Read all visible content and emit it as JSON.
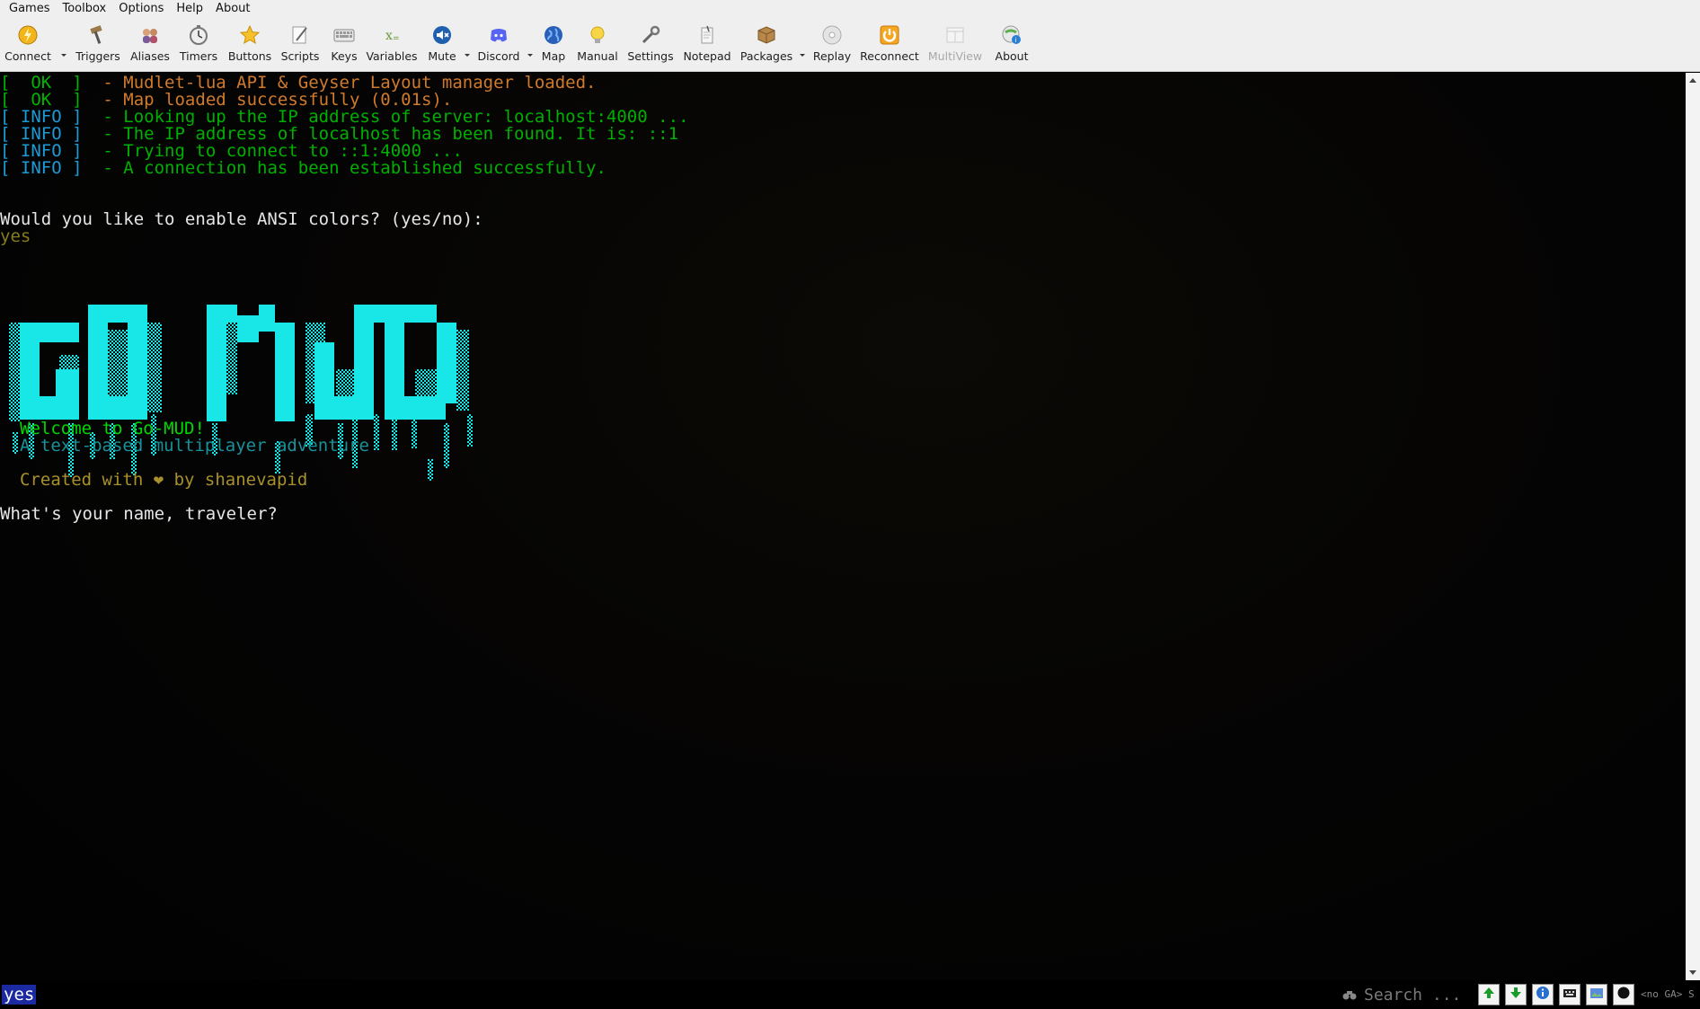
{
  "menu": [
    "Games",
    "Toolbox",
    "Options",
    "Help",
    "About"
  ],
  "toolbar": {
    "connect": "Connect",
    "triggers": "Triggers",
    "aliases": "Aliases",
    "timers": "Timers",
    "buttons": "Buttons",
    "scripts": "Scripts",
    "keys": "Keys",
    "variables": "Variables",
    "mute": "Mute",
    "discord": "Discord",
    "map": "Map",
    "manual": "Manual",
    "settings": "Settings",
    "notepad": "Notepad",
    "packages": "Packages",
    "replay": "Replay",
    "reconnect": "Reconnect",
    "multiview": "MultiView",
    "about": "About"
  },
  "console": {
    "log": [
      {
        "open": "[  ",
        "status": "OK",
        "close": "  ]",
        "message": "  - Mudlet-lua API & Geyser Layout manager loaded.",
        "kind": "ok",
        "color": "#d07a2c"
      },
      {
        "open": "[  ",
        "status": "OK",
        "close": "  ]",
        "message": "  - Map loaded successfully (0.01s).",
        "kind": "ok",
        "color": "#d07a2c"
      },
      {
        "open": "[ ",
        "status": "INFO",
        "close": " ]",
        "message": "  - Looking up the IP address of server: localhost:4000 ...",
        "kind": "info",
        "color": "#00b000"
      },
      {
        "open": "[ ",
        "status": "INFO",
        "close": " ]",
        "message": "  - The IP address of localhost has been found. It is: ::1",
        "kind": "info",
        "color": "#00b000"
      },
      {
        "open": "[ ",
        "status": "INFO",
        "close": " ]",
        "message": "  - Trying to connect to ::1:4000 ...",
        "kind": "info",
        "color": "#00b000"
      },
      {
        "open": "[ ",
        "status": "INFO",
        "close": " ]",
        "message": "  - A connection has been established successfully.",
        "kind": "info",
        "color": "#00b000"
      }
    ],
    "ansi_prompt": "Would you like to enable ANSI colors? (yes/no):",
    "echo": "yes",
    "logo_text": "GO MUD",
    "welcome": "Welcome to Go-MUD!",
    "tagline": "A text-based multiplayer adventure",
    "credit": "Created with ❤ by shanevapid",
    "name_prompt": "What's your name, traveler?"
  },
  "bottom": {
    "command": "yes",
    "search_placeholder": "Search ...",
    "ga_status": "<no GA> S"
  },
  "colors": {
    "logo_cyan": "#19e6e6",
    "command_bg": "#1b2aa0",
    "ok_green": "#00b300",
    "info_blue": "#1e9bd6"
  }
}
